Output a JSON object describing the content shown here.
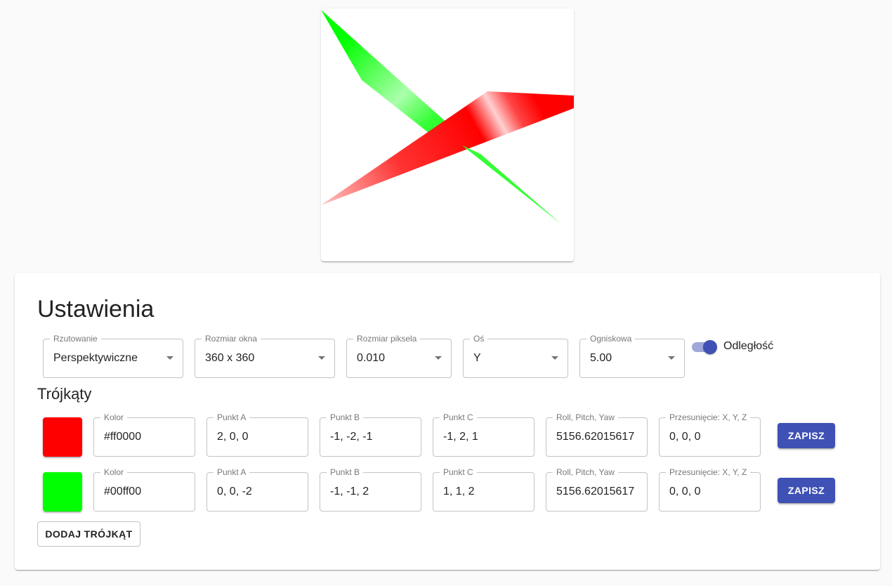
{
  "render": {
    "background": "#ffffff",
    "triangle_colors": [
      "#ff0000",
      "#00ff00"
    ]
  },
  "settings": {
    "title": "Ustawienia",
    "projection": {
      "label": "Rzutowanie",
      "value": "Perspektywiczne"
    },
    "window_size": {
      "label": "Rozmiar okna",
      "value": "360 x 360"
    },
    "pixel_size": {
      "label": "Rozmiar piksela",
      "value": "0.010"
    },
    "axis": {
      "label": "Oś",
      "value": "Y"
    },
    "focal": {
      "label": "Ogniskowa",
      "value": "5.00"
    },
    "distance_toggle": {
      "label": "Odległość",
      "checked": true
    }
  },
  "triangles": {
    "title": "Trójkąty",
    "labels": {
      "color": "Kolor",
      "point_a": "Punkt A",
      "point_b": "Punkt B",
      "point_c": "Punkt C",
      "rotation": "Roll, Pitch, Yaw",
      "translation": "Przesunięcie: X, Y, Z"
    },
    "items": [
      {
        "color": "#ff0000",
        "point_a": "2, 0, 0",
        "point_b": "-1, -2, -1",
        "point_c": "-1, 2, 1",
        "rotation": "5156.62015617",
        "translation": "0, 0, 0",
        "save_label": "ZAPISZ"
      },
      {
        "color": "#00ff00",
        "point_a": "0, 0, -2",
        "point_b": "-1, -1, 2",
        "point_c": "1, 1, 2",
        "rotation": "5156.62015617",
        "translation": "0, 0, 0",
        "save_label": "ZAPISZ"
      }
    ],
    "add_label": "DODAJ TRÓJKĄT"
  },
  "colors": {
    "primary": "#3f51b5",
    "page_background": "#fafafa"
  }
}
